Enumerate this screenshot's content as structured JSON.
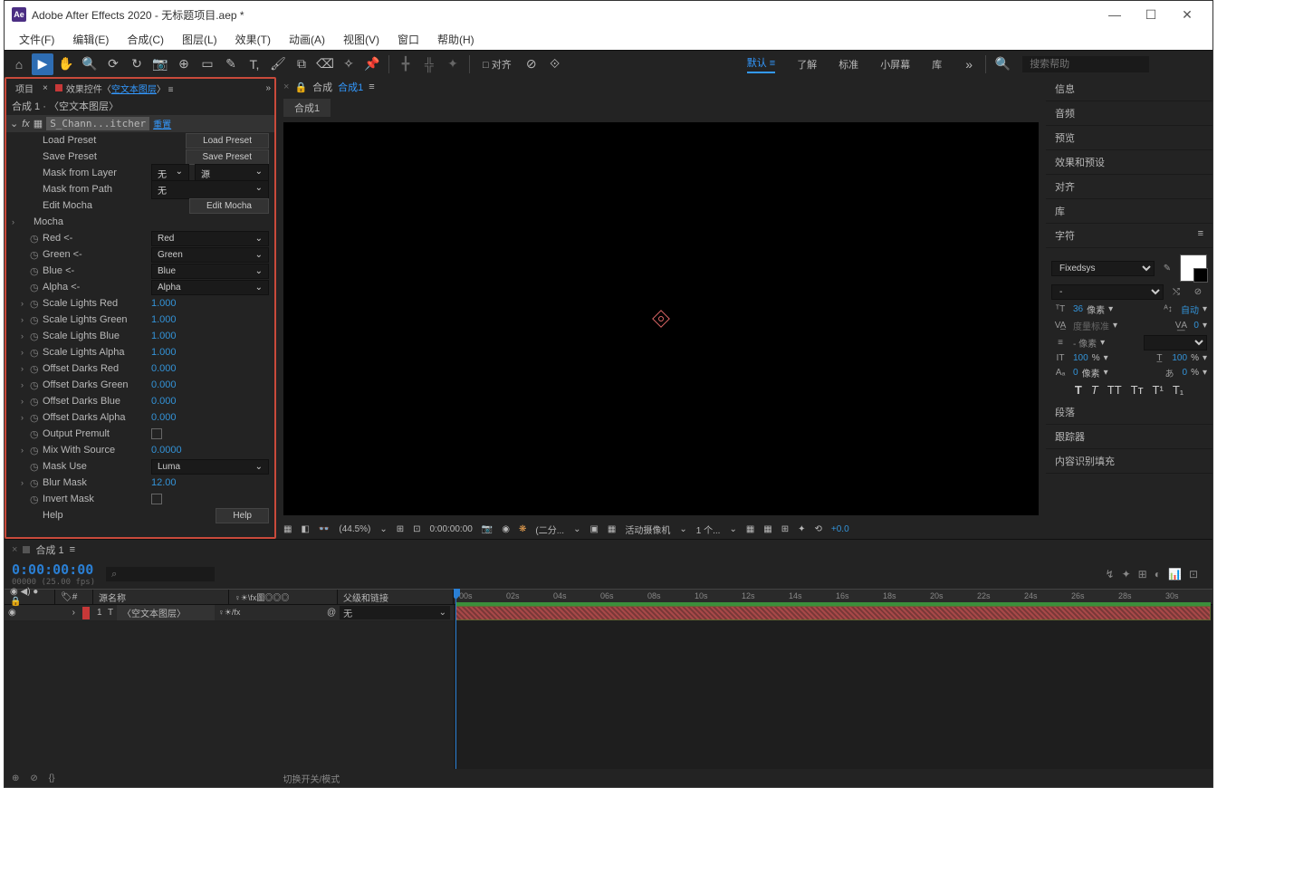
{
  "titlebar": {
    "app_icon": "Ae",
    "title": "Adobe After Effects 2020 - 无标题项目.aep *"
  },
  "menu": [
    "文件(F)",
    "编辑(E)",
    "合成(C)",
    "图层(L)",
    "效果(T)",
    "动画(A)",
    "视图(V)",
    "窗口",
    "帮助(H)"
  ],
  "toolbar": {
    "snap": "□ 对齐",
    "workspaces": [
      "默认",
      "了解",
      "标准",
      "小屏幕",
      "库"
    ],
    "search_placeholder": "搜索帮助"
  },
  "effect_panel": {
    "tab_prefix": "效果控件",
    "tab_link": "空文本图层",
    "breadcrumb": "合成 1 · 〈空文本图层〉",
    "effect_name": "S_Chann...itcher",
    "reset": "重置",
    "props": [
      {
        "label": "Load Preset",
        "type": "btn",
        "btn": "Load Preset"
      },
      {
        "label": "Save Preset",
        "type": "btn",
        "btn": "Save Preset"
      },
      {
        "label": "Mask from Layer",
        "type": "dd2",
        "v1": "无",
        "v2": "源"
      },
      {
        "label": "Mask from Path",
        "type": "dd",
        "val": "无"
      },
      {
        "label": "Edit Mocha",
        "type": "btn",
        "btn": "Edit Mocha"
      },
      {
        "label": "Mocha",
        "type": "group"
      },
      {
        "label": "Red <-",
        "type": "dd",
        "val": "Red",
        "sw": true
      },
      {
        "label": "Green <-",
        "type": "dd",
        "val": "Green",
        "sw": true
      },
      {
        "label": "Blue <-",
        "type": "dd",
        "val": "Blue",
        "sw": true
      },
      {
        "label": "Alpha <-",
        "type": "dd",
        "val": "Alpha",
        "sw": true
      },
      {
        "label": "Scale Lights Red",
        "type": "num",
        "val": "1.000",
        "sw": true,
        "arr": true
      },
      {
        "label": "Scale Lights Green",
        "type": "num",
        "val": "1.000",
        "sw": true,
        "arr": true
      },
      {
        "label": "Scale Lights Blue",
        "type": "num",
        "val": "1.000",
        "sw": true,
        "arr": true
      },
      {
        "label": "Scale Lights Alpha",
        "type": "num",
        "val": "1.000",
        "sw": true,
        "arr": true
      },
      {
        "label": "Offset Darks Red",
        "type": "num",
        "val": "0.000",
        "sw": true,
        "arr": true
      },
      {
        "label": "Offset Darks Green",
        "type": "num",
        "val": "0.000",
        "sw": true,
        "arr": true
      },
      {
        "label": "Offset Darks Blue",
        "type": "num",
        "val": "0.000",
        "sw": true,
        "arr": true
      },
      {
        "label": "Offset Darks Alpha",
        "type": "num",
        "val": "0.000",
        "sw": true,
        "arr": true
      },
      {
        "label": "Output Premult",
        "type": "chk",
        "sw": true
      },
      {
        "label": "Mix With Source",
        "type": "num",
        "val": "0.0000",
        "sw": true,
        "arr": true
      },
      {
        "label": "Mask Use",
        "type": "dd",
        "val": "Luma",
        "sw": true
      },
      {
        "label": "Blur Mask",
        "type": "num",
        "val": "12.00",
        "sw": true,
        "arr": true
      },
      {
        "label": "Invert Mask",
        "type": "chk",
        "sw": true
      },
      {
        "label": "Help",
        "type": "btn",
        "btn": "Help"
      }
    ]
  },
  "composition": {
    "tab_label": "合成",
    "comp_name": "合成1",
    "crumb": "合成1"
  },
  "viewer_footer": {
    "zoom": "(44.5%)",
    "time": "0:00:00:00",
    "res": "(二分...",
    "cam": "活动摄像机",
    "views": "1 个...",
    "exp": "+0.0"
  },
  "right_sections": [
    "信息",
    "音频",
    "预览",
    "效果和预设",
    "对齐",
    "库"
  ],
  "char": {
    "title": "字符",
    "font": "Fixedsys",
    "style": "-",
    "size": "36",
    "size_unit": "像素",
    "leading": "自动",
    "kerning": "度量标准",
    "tracking": "0",
    "baseline_unit": "- 像素",
    "vscale": "100",
    "hscale": "100",
    "baseline": "0",
    "baseline_u": "像素",
    "stroke": "0",
    "stroke_u": "%"
  },
  "right_sections2": [
    "段落",
    "跟踪器",
    "内容识别填充"
  ],
  "timeline": {
    "tab": "合成 1",
    "timecode": "0:00:00:00",
    "timecode_sub": "00000 (25.00 fps)",
    "search_ph": "⌕",
    "cols": {
      "eye_w": 56,
      "idx": "#",
      "src": "源名称",
      "switches": "♀☀\\fx圖◎◎◎",
      "parent": "父级和链接"
    },
    "layer": {
      "idx": "1",
      "type": "T",
      "name": "〈空文本图层〉",
      "switches": "♀☀/fx",
      "parent": "无"
    },
    "ticks": [
      "00s",
      "02s",
      "04s",
      "06s",
      "08s",
      "10s",
      "12s",
      "14s",
      "16s",
      "18s",
      "20s",
      "22s",
      "24s",
      "26s",
      "28s",
      "30s"
    ],
    "footer": "切换开关/模式"
  }
}
